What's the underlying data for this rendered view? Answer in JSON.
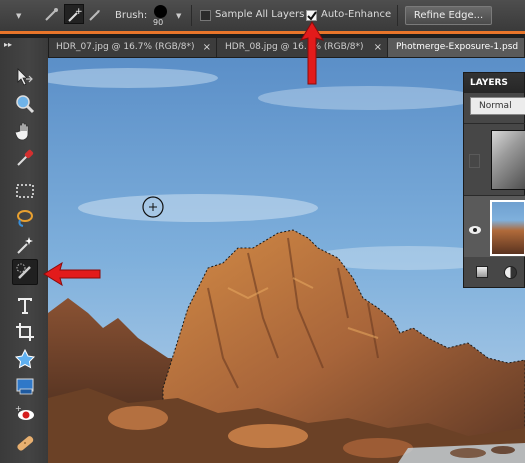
{
  "options_bar": {
    "brush_label": "Brush:",
    "brush_size": "90",
    "sample_all_layers_label": "Sample All Layers",
    "sample_all_layers_checked": false,
    "auto_enhance_label": "Auto-Enhance",
    "auto_enhance_checked": true,
    "refine_edge_label": "Refine Edge..."
  },
  "tabs": [
    {
      "label": "HDR_07.jpg @ 16.7% (RGB/8*)",
      "close": "×",
      "active": false
    },
    {
      "label": "HDR_08.jpg @ 16.7% (RGB/8*)",
      "close": "×",
      "active": false
    },
    {
      "label": "Photmerge-Exposure-1.psd",
      "close": "",
      "active": true
    }
  ],
  "toolbox": {
    "collapse_glyph": "▸▸",
    "tools": [
      "move-tool",
      "zoom-tool",
      "hand-tool",
      "eyedropper-tool",
      "rectangular-marquee-tool",
      "lasso-tool",
      "magic-wand-tool",
      "quick-selection-tool",
      "type-tool",
      "crop-tool",
      "cookie-cutter-tool",
      "straighten-tool",
      "red-eye-tool",
      "spot-healing-tool"
    ],
    "selected": "quick-selection-tool"
  },
  "layers_panel": {
    "title": "LAYERS",
    "blend_mode": "Normal"
  },
  "annotations": {
    "arrow_color": "#e21b1b"
  },
  "colors": {
    "accent": "#e8752a"
  }
}
